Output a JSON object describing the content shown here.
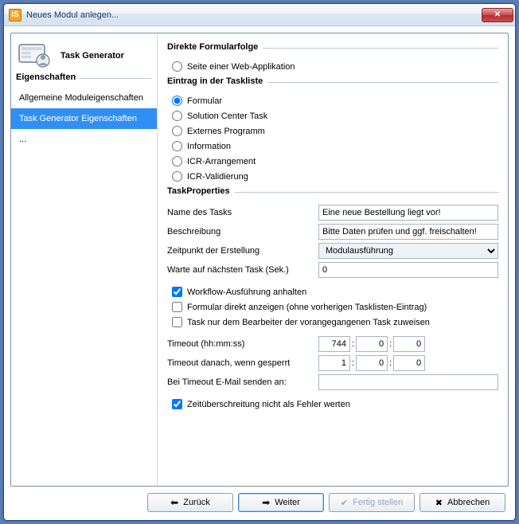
{
  "window": {
    "title": "Neues Modul anlegen..."
  },
  "sidebar": {
    "header": "Task Generator",
    "section": "Eigenschaften",
    "items": [
      {
        "label": "Allgemeine Moduleigenschaften",
        "selected": false
      },
      {
        "label": "Task Generator Eigenschaften",
        "selected": true
      },
      {
        "label": "...",
        "selected": false
      }
    ]
  },
  "direct": {
    "title": "Direkte Formularfolge",
    "opt1": "Seite einer Web-Applikation"
  },
  "tasklist": {
    "title": "Eintrag in der Taskliste",
    "opt1": "Formular",
    "opt2": "Solution Center Task",
    "opt3": "Externes Programm",
    "opt4": "Information",
    "opt5": "ICR-Arrangement",
    "opt6": "ICR-Validierung"
  },
  "props": {
    "title": "TaskProperties",
    "name_label": "Name des Tasks",
    "name_value": "Eine neue Bestellung liegt vor!",
    "desc_label": "Beschreibung",
    "desc_value": "Bitte Daten prüfen und ggf. freischalten!",
    "time_label": "Zeitpunkt der Erstellung",
    "time_value": "Modulausführung",
    "wait_label": "Warte auf nächsten Task (Sek.)",
    "wait_value": "0",
    "chk1": "Workflow-Ausführung anhalten",
    "chk2": "Formular direkt anzeigen (ohne vorherigen Tasklisten-Eintrag)",
    "chk3": "Task nur dem Bearbeiter der vorangegangenen Task zuweisen",
    "timeout_label": "Timeout (hh:mm:ss)",
    "timeout_h": "744",
    "timeout_m": "0",
    "timeout_s": "0",
    "timeout2_label": "Timeout danach, wenn gesperrt",
    "timeout2_h": "1",
    "timeout2_m": "0",
    "timeout2_s": "0",
    "email_label": "Bei Timeout E-Mail senden an:",
    "email_value": "",
    "chk4": "Zeitüberschreitung nicht als Fehler werten"
  },
  "footer": {
    "back": "Zurück",
    "next": "Weiter",
    "finish": "Fertig stellen",
    "cancel": "Abbrechen"
  }
}
